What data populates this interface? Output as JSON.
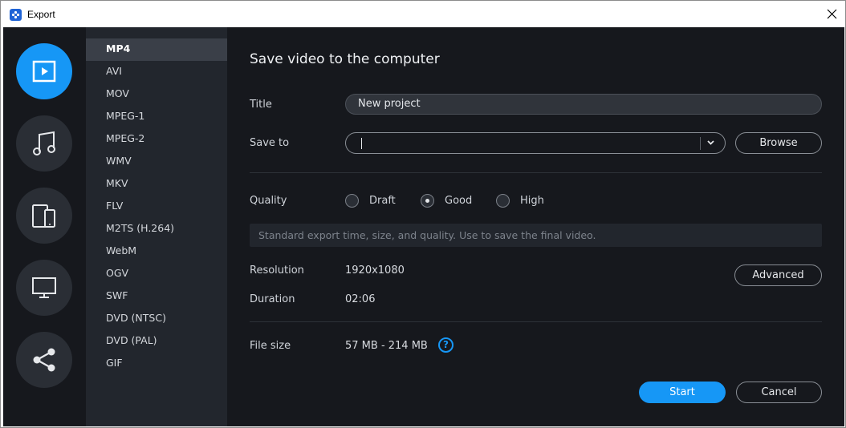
{
  "window": {
    "title": "Export",
    "icon": "app-logo-icon",
    "close_icon": "close-icon"
  },
  "rail": {
    "items": [
      {
        "name": "video",
        "icon": "video-play-icon",
        "active": true
      },
      {
        "name": "audio",
        "icon": "music-note-icon",
        "active": false
      },
      {
        "name": "devices",
        "icon": "mobile-devices-icon",
        "active": false
      },
      {
        "name": "tv",
        "icon": "monitor-icon",
        "active": false
      },
      {
        "name": "share",
        "icon": "share-icon",
        "active": false
      }
    ]
  },
  "formats": {
    "items": [
      "MP4",
      "AVI",
      "MOV",
      "MPEG-1",
      "MPEG-2",
      "WMV",
      "MKV",
      "FLV",
      "M2TS (H.264)",
      "WebM",
      "OGV",
      "SWF",
      "DVD (NTSC)",
      "DVD (PAL)",
      "GIF"
    ],
    "selected": "MP4"
  },
  "panel": {
    "heading": "Save video to the computer",
    "title_label": "Title",
    "title_value": "New project",
    "save_to_label": "Save to",
    "save_to_value": "",
    "browse_label": "Browse",
    "quality_label": "Quality",
    "quality_options": [
      "Draft",
      "Good",
      "High"
    ],
    "quality_selected": "Good",
    "quality_hint": "Standard export time, size, and quality. Use to save the final video.",
    "resolution_label": "Resolution",
    "resolution_value": "1920x1080",
    "advanced_label": "Advanced",
    "duration_label": "Duration",
    "duration_value": "02:06",
    "filesize_label": "File size",
    "filesize_value": "57 MB - 214 MB",
    "help_glyph": "?",
    "start_label": "Start",
    "cancel_label": "Cancel"
  },
  "colors": {
    "accent": "#1697f6",
    "background": "#16181d",
    "sidebar": "#22262d",
    "selected_item": "#3a3f48"
  }
}
